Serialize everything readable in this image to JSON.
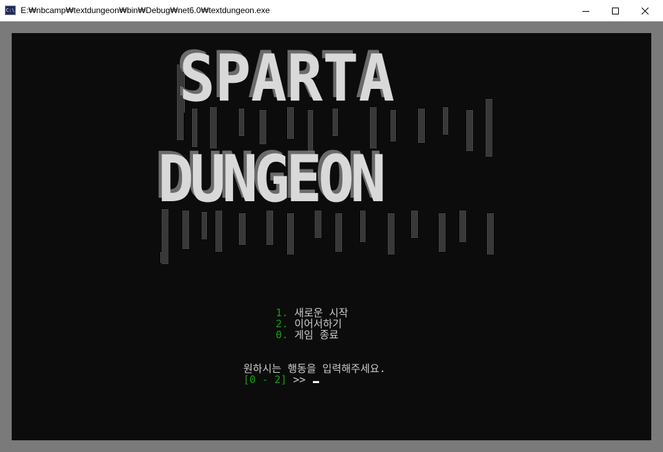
{
  "window": {
    "icon_label": "C:\\",
    "title": "E:₩nbcamp₩textdungeon₩bin₩Debug₩net6.0₩textdungeon.exe",
    "controls": [
      "minimize",
      "maximize",
      "close"
    ]
  },
  "console": {
    "banner_lines": [
      "SPARTA",
      "DUNGEON"
    ],
    "menu": [
      {
        "key": "1.",
        "label": "새로운 시작"
      },
      {
        "key": "2.",
        "label": "이어서하기"
      },
      {
        "key": "0.",
        "label": "게임 종료"
      }
    ],
    "prompt": "원하시는 행동을 입력해주세요.",
    "input_range": "[0 - 2]",
    "input_arrows": ">>",
    "colors": {
      "background": "#0c0c0c",
      "text": "#cccccc",
      "accent": "#13a10e"
    }
  }
}
